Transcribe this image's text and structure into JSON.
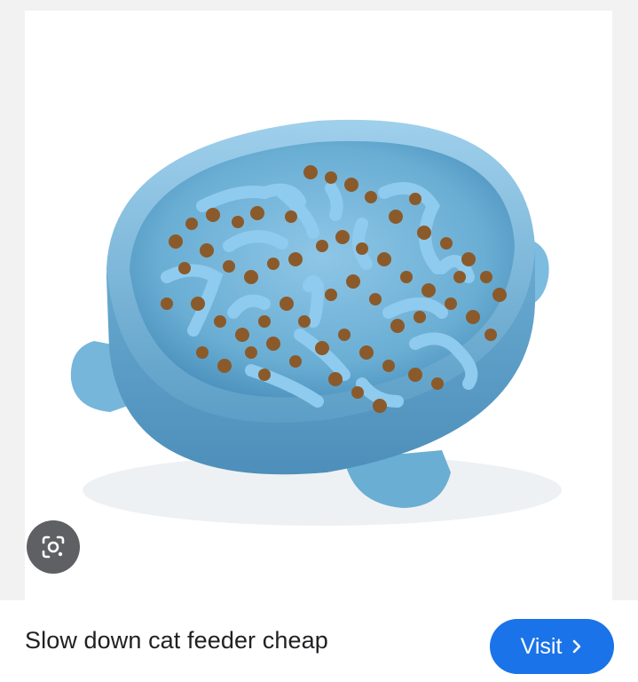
{
  "image": {
    "alt_icon": "slow-feeder-bowl-image",
    "lens_icon": "google-lens-icon"
  },
  "result": {
    "title": "Slow down cat feeder cheap",
    "visit_label": "Visit",
    "visit_icon": "chevron-right-icon"
  },
  "colors": {
    "bowl": "#6aaed4",
    "accent": "#1a73e8",
    "lens_bg": "#5f6063"
  }
}
